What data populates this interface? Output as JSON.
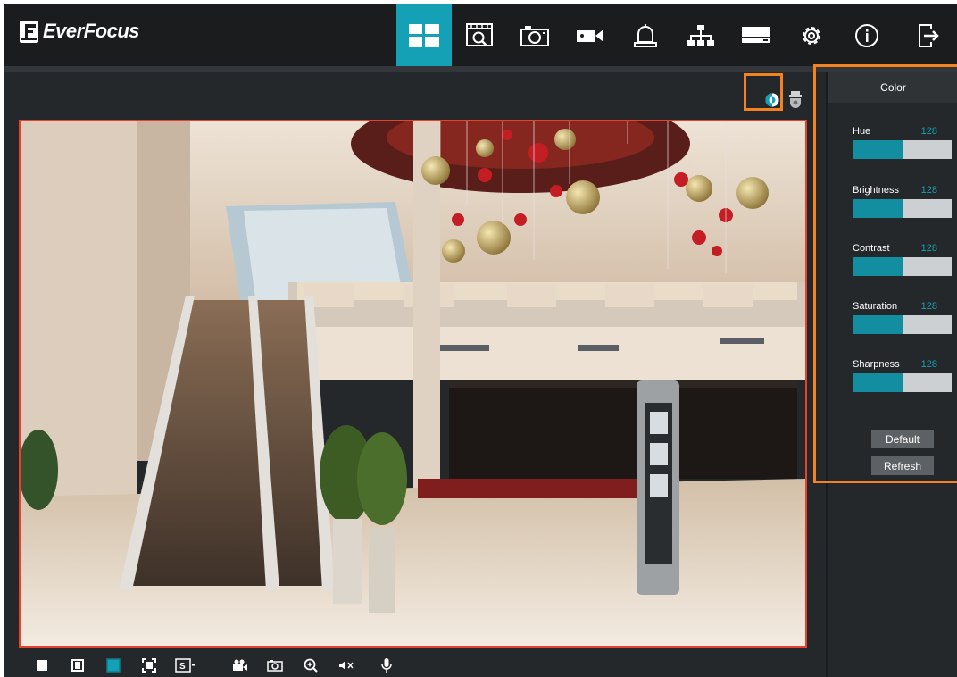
{
  "app": {
    "brand": "EverFocus"
  },
  "nav": {
    "items": [
      {
        "name": "live-view",
        "icon": "grid-layout-icon",
        "active": true
      },
      {
        "name": "playback",
        "icon": "playback-film-icon",
        "active": false
      },
      {
        "name": "snapshot",
        "icon": "camera-icon",
        "active": false
      },
      {
        "name": "record",
        "icon": "video-camera-icon",
        "active": false
      },
      {
        "name": "alarm",
        "icon": "alarm-bell-icon",
        "active": false
      },
      {
        "name": "network",
        "icon": "network-icon",
        "active": false
      },
      {
        "name": "storage",
        "icon": "hard-drive-icon",
        "active": false
      },
      {
        "name": "settings",
        "icon": "gear-icon",
        "active": false
      },
      {
        "name": "info",
        "icon": "info-icon",
        "active": false
      },
      {
        "name": "logout",
        "icon": "logout-icon",
        "active": false
      }
    ],
    "active_color": "#14a1b5"
  },
  "live": {
    "tools": [
      {
        "name": "color-adjust",
        "icon": "contrast-half-circle-icon",
        "highlighted": true
      },
      {
        "name": "ptz",
        "icon": "dome-camera-icon",
        "highlighted": false
      }
    ]
  },
  "bottom_toolbar": {
    "items": [
      {
        "name": "stop",
        "icon": "square-stop-icon"
      },
      {
        "name": "original-size",
        "icon": "frame-icon"
      },
      {
        "name": "stretch",
        "icon": "fill-screen-icon",
        "active": true
      },
      {
        "name": "fullscreen",
        "icon": "fullscreen-icon"
      },
      {
        "name": "stream-select",
        "icon": "stream-s-icon"
      },
      {
        "name": "record",
        "icon": "video-camera-icon"
      },
      {
        "name": "snapshot",
        "icon": "camera-icon"
      },
      {
        "name": "zoom",
        "icon": "zoom-in-icon"
      },
      {
        "name": "audio",
        "icon": "mute-icon"
      },
      {
        "name": "talk",
        "icon": "microphone-icon"
      }
    ]
  },
  "color_panel": {
    "title": "Color",
    "sliders": [
      {
        "label": "Hue",
        "value": "128",
        "fraction": 0.502
      },
      {
        "label": "Brightness",
        "value": "128",
        "fraction": 0.502
      },
      {
        "label": "Contrast",
        "value": "128",
        "fraction": 0.502
      },
      {
        "label": "Saturation",
        "value": "128",
        "fraction": 0.502
      },
      {
        "label": "Sharpness",
        "value": "128",
        "fraction": 0.502
      }
    ],
    "default_label": "Default",
    "refresh_label": "Refresh"
  },
  "colors": {
    "highlight": "#f58220",
    "slider_fill": "#138ea0",
    "video_border": "#e8412c"
  }
}
